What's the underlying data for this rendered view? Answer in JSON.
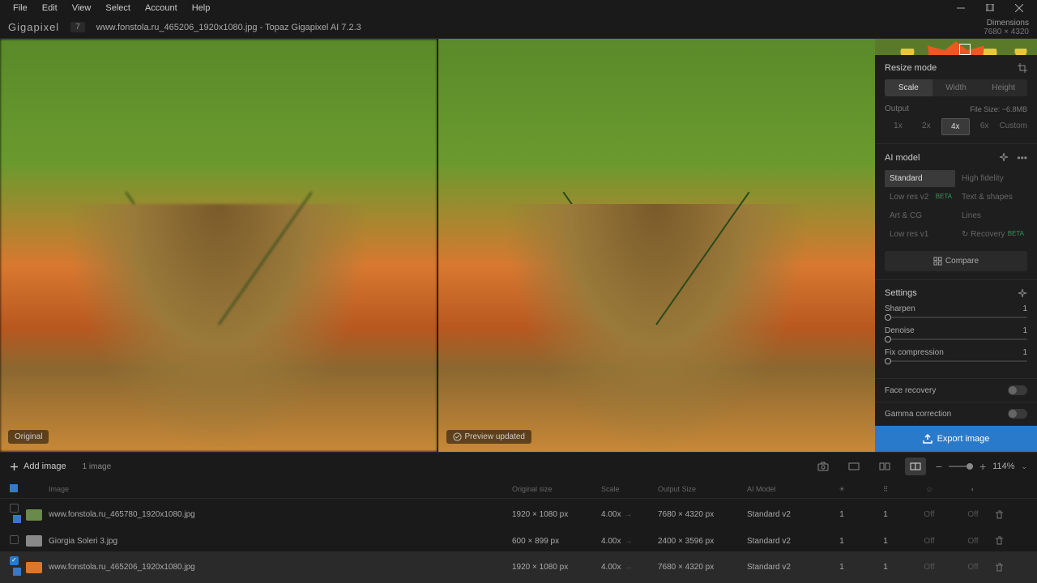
{
  "menu": [
    "File",
    "Edit",
    "View",
    "Select",
    "Account",
    "Help"
  ],
  "app_name": "Gigapixel",
  "badge_count": "7",
  "file_title": "www.fonstola.ru_465206_1920x1080.jpg - Topaz Gigapixel AI 7.2.3",
  "dimensions_label": "Dimensions",
  "dimensions_value": "7680 × 4320",
  "original_label": "Original",
  "preview_updated": "Preview updated",
  "resize_mode": {
    "title": "Resize mode",
    "options": [
      "Scale",
      "Width",
      "Height"
    ],
    "output_label": "Output",
    "file_size": "File Size: ~6.8MB",
    "scales": [
      "1x",
      "2x",
      "4x",
      "6x",
      "Custom"
    ]
  },
  "ai_model": {
    "title": "AI model",
    "options": [
      "Standard",
      "High fidelity",
      "Low res v2",
      "Text & shapes",
      "Art & CG",
      "Lines",
      "Low res v1",
      "Recovery"
    ],
    "beta": "BETA",
    "compare": "Compare"
  },
  "settings": {
    "title": "Settings",
    "sharpen": "Sharpen",
    "sharpen_val": "1",
    "denoise": "Denoise",
    "denoise_val": "1",
    "fix_compression": "Fix compression",
    "fix_val": "1"
  },
  "face_recovery": "Face recovery",
  "gamma_correction": "Gamma correction",
  "export": "Export image",
  "bottom": {
    "add_image": "Add image",
    "count": "1 image",
    "zoom": "114%"
  },
  "table": {
    "headers": {
      "image": "Image",
      "original": "Original size",
      "scale": "Scale",
      "output": "Output Size",
      "model": "AI Model"
    },
    "rows": [
      {
        "checked": false,
        "color": "#3878c8",
        "thumb": "#6a8a4a",
        "name": "www.fonstola.ru_465780_1920x1080.jpg",
        "original": "1920 × 1080 px",
        "scale": "4.00x",
        "output": "7680 × 4320 px",
        "model": "Standard v2",
        "s1": "1",
        "s2": "1",
        "o1": "Off",
        "o2": "Off"
      },
      {
        "checked": false,
        "color": "",
        "thumb": "#888",
        "name": "Giorgia Soleri 3.jpg",
        "original": "600 × 899 px",
        "scale": "4.00x",
        "output": "2400 × 3596 px",
        "model": "Standard v2",
        "s1": "1",
        "s2": "1",
        "o1": "Off",
        "o2": "Off"
      },
      {
        "checked": true,
        "color": "#3878c8",
        "thumb": "#d87830",
        "name": "www.fonstola.ru_465206_1920x1080.jpg",
        "original": "1920 × 1080 px",
        "scale": "4.00x",
        "output": "7680 × 4320 px",
        "model": "Standard v2",
        "s1": "1",
        "s2": "1",
        "o1": "Off",
        "o2": "Off"
      }
    ]
  }
}
